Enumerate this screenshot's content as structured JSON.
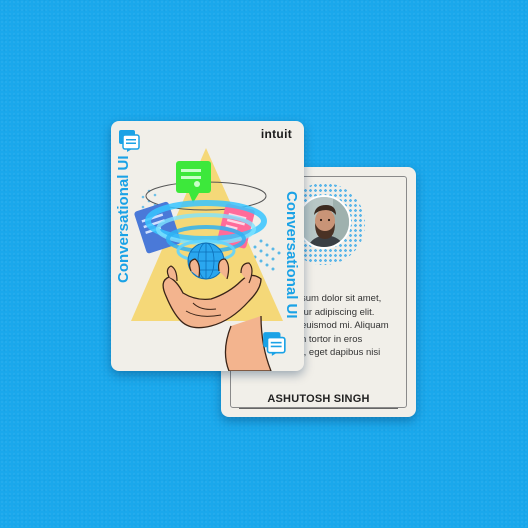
{
  "front_card": {
    "brand": "intuit",
    "vertical_title_left": "Conversational UI",
    "vertical_title_right": "Conversational UI",
    "corner_icon": "chat-bubble-icon",
    "illustration": "hand-holding-hologram-chat-bubbles",
    "colors": {
      "accent": "#1aa2e6",
      "triangle": "#f2d97a",
      "green": "#39e83a",
      "pink": "#ff5f93",
      "blue": "#4a79d8"
    }
  },
  "back_card": {
    "bio_lines": [
      "sum dolor sit amet,",
      "tur adipiscing elit.",
      "euismod mi. Aliquam",
      "n tortor in eros",
      "t, eget dapibus nisi"
    ],
    "name": "ASHUTOSH SINGH",
    "avatar": "bearded-man-portrait"
  },
  "background_color": "#1aa8ec"
}
